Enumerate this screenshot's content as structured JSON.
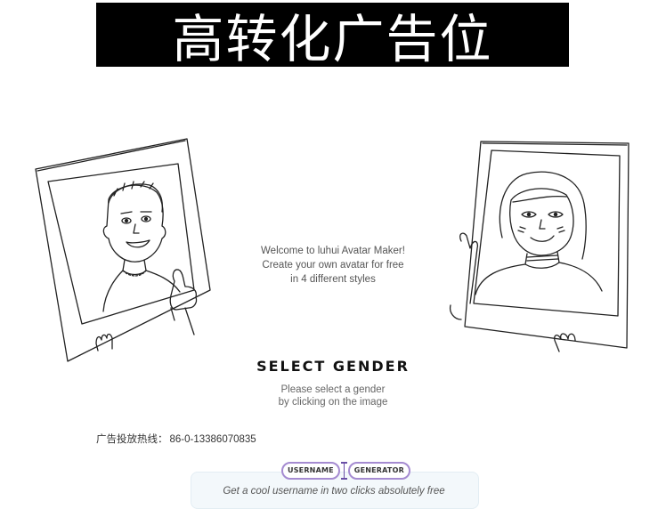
{
  "banner": {
    "text": "高转化广告位"
  },
  "intro": {
    "line1": "Welcome to luhui Avatar Maker!",
    "line2": "Create your own avatar for free",
    "line3": "in 4 different styles"
  },
  "gender": {
    "title": "SELECT GENDER",
    "hint_line1": "Please select a gender",
    "hint_line2": "by clicking on the image"
  },
  "hotline": {
    "label": "广告投放热线：",
    "number": "86-0-13386070835"
  },
  "username_generator": {
    "logo_left": "USERNAME",
    "logo_right": "GENERATOR",
    "tagline": "Get a cool username in two clicks absolutely free"
  },
  "colors": {
    "accent": "#a58bd1",
    "banner_bg": "#000000",
    "box_bg": "#f3f8fb"
  }
}
